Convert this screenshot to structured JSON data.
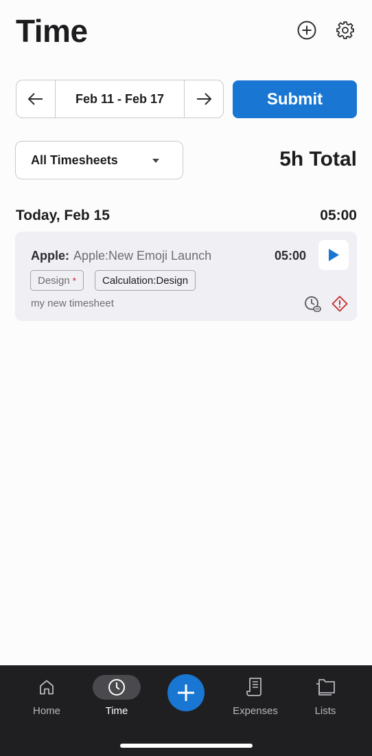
{
  "header": {
    "title": "Time"
  },
  "week": {
    "range": "Feb 11 - Feb 17"
  },
  "actions": {
    "submit_label": "Submit"
  },
  "filter": {
    "selected": "All Timesheets"
  },
  "summary": {
    "total": "5h Total"
  },
  "day": {
    "label": "Today, Feb 15",
    "total": "05:00",
    "entries": [
      {
        "client": "Apple:",
        "project": "Apple:New Emoji Launch",
        "duration": "05:00",
        "tags": [
          {
            "label": "Design",
            "required_mark": "*"
          },
          {
            "label": "Calculation:Design"
          }
        ],
        "note": "my new timesheet"
      }
    ]
  },
  "tabbar": {
    "items": [
      {
        "label": "Home",
        "icon": "home-icon"
      },
      {
        "label": "Time",
        "icon": "clock-icon",
        "active": true
      },
      {
        "label": "",
        "icon": "plus-icon"
      },
      {
        "label": "Expenses",
        "icon": "receipt-icon"
      },
      {
        "label": "Lists",
        "icon": "folder-icon"
      }
    ]
  },
  "colors": {
    "accent": "#1976d2",
    "warning": "#c62828",
    "card_bg": "#efeff4",
    "tabbar_bg": "#1f1f21"
  }
}
